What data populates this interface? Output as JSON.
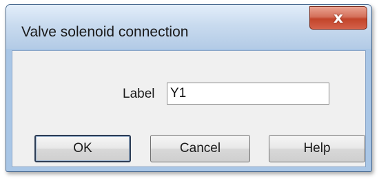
{
  "window": {
    "title": "Valve solenoid connection",
    "close_glyph": "x"
  },
  "form": {
    "label_caption": "Label",
    "label_value": "Y1"
  },
  "buttons": {
    "ok": "OK",
    "cancel": "Cancel",
    "help": "Help"
  },
  "colors": {
    "close_button": "#c2442a",
    "titlebar": "#c9dbef",
    "client_bg": "#f0f0f0"
  }
}
